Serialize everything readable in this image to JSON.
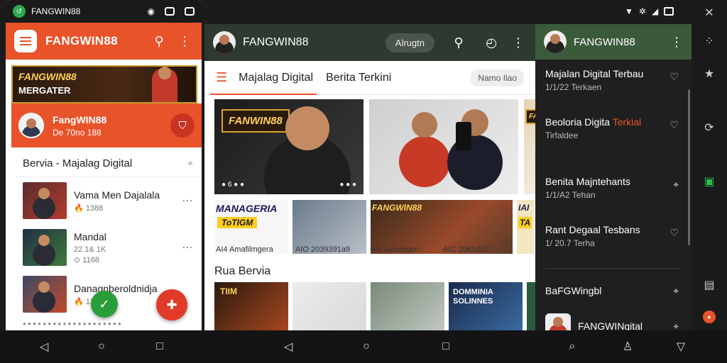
{
  "phone": {
    "status_title": "FANGWIN88",
    "app_title": "FANGWIN88",
    "banner_line1": "FANGWIN88",
    "banner_line2": "MERGATER",
    "profile_name": "FangWIN88",
    "profile_sub": "De 70no 188",
    "list_title": "Bervia - Majalag Digital",
    "items": [
      {
        "name": "Vama Men Dajalala",
        "stat": "🔥 1388",
        "meta": ""
      },
      {
        "name": "Mandal",
        "stat": "22 1& 1K",
        "meta": "⊙ 1168"
      },
      {
        "name": "Danagnberoldnidja",
        "stat": "🔥 1388",
        "meta": ""
      }
    ],
    "bottom_text": "● ● ● ● ● ● ● ● ● ● ● ● ● ● ●   ● ● ● ● ●"
  },
  "middle": {
    "title": "FANGWIN88",
    "login": "Alrugtn",
    "tab1": "Majalag Digital",
    "tab2": "Berita Terkini",
    "search_pill": "Namo Ilao",
    "feature_logo": "FANWIN88",
    "feature_logo2": "FANW",
    "feat_dots_left": "● 6 ● ●",
    "feat_dots_right": "● ● ●",
    "mini1_title": "MANAGERIA",
    "mini1_badge": "ToTIGM",
    "mini3_title": "FANGWIN88",
    "mini4_title": "IAI",
    "mini4_badge": "TA",
    "captions": [
      "AI4 Amafilmgera",
      "AIO 2039391a9",
      "AI4 Awaregen",
      "AIC 2081d37"
    ],
    "section_title": "Rua Bervia",
    "tile_d_text": "DOMMINIA SOLINNES",
    "tile_a_text": "TIIM"
  },
  "drawer": {
    "title": "FANGWIN88",
    "items": [
      {
        "title": "Majalan Digital Terbau",
        "title_accent": "",
        "sub": "1/1/22 Terkaen"
      },
      {
        "title": "Beoloria Digita ",
        "title_accent": "Terkial",
        "sub": "Tirfaldee"
      },
      {
        "title": "Benita Majntehants",
        "title_accent": "",
        "sub": "1/1/A2 Tehan"
      },
      {
        "title": "Rant Degaal Tesbans",
        "title_accent": "",
        "sub": "1/ 20.7 Terha"
      }
    ],
    "row1": "BaFGWingbl",
    "row2": "FANGWINgital"
  },
  "colors": {
    "accent": "#e8532a",
    "dark_header": "#2e3a2f",
    "drawer_header": "#3b5a3a",
    "green": "#2a9d3b"
  }
}
